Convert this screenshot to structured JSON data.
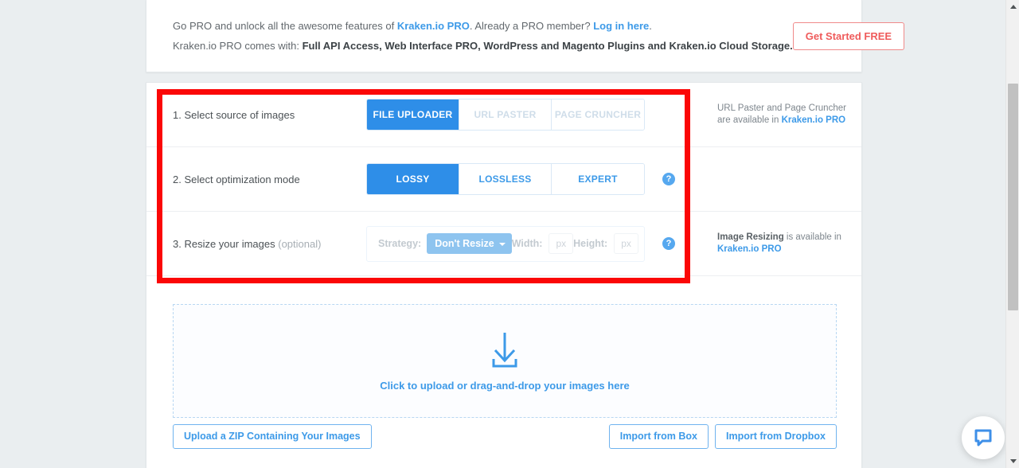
{
  "banner": {
    "line1_part1": "Go PRO and unlock all the awesome features of ",
    "line1_link1": "Kraken.io PRO",
    "line1_part2": ". Already a PRO member? ",
    "line1_link2": "Log in here",
    "line1_part3": ".",
    "line2_part1": "Kraken.io PRO comes with: ",
    "line2_bold": "Full API Access, Web Interface PRO, WordPress and Magento Plugins and Kraken.io Cloud Storage.",
    "cta_label": "Get Started FREE"
  },
  "steps": {
    "step1": {
      "label": "1. Select source of images",
      "options": [
        {
          "label": "FILE UPLOADER",
          "state": "active"
        },
        {
          "label": "URL PASTER",
          "state": "disabled"
        },
        {
          "label": "PAGE CRUNCHER",
          "state": "disabled"
        }
      ],
      "note_part1": "URL Paster and Page Cruncher",
      "note_part2": "are available in ",
      "note_link": "Kraken.io PRO"
    },
    "step2": {
      "label": "2. Select optimization mode",
      "options": [
        {
          "label": "LOSSY",
          "state": "active"
        },
        {
          "label": "LOSSLESS",
          "state": "normal"
        },
        {
          "label": "EXPERT",
          "state": "normal"
        }
      ],
      "help_glyph": "?"
    },
    "step3": {
      "label": "3. Resize your images ",
      "label_optional": "(optional)",
      "strategy_label": "Strategy:",
      "strategy_value": "Don't Resize",
      "width_label": "Width:",
      "width_value": "",
      "width_placeholder": "px",
      "height_label": "Height:",
      "height_value": "",
      "height_placeholder": "px",
      "help_glyph": "?",
      "note_bold": "Image Resizing",
      "note_part2": " is available in",
      "note_link": "Kraken.io PRO"
    }
  },
  "dropzone": {
    "text": "Click to upload or drag-and-drop your images here",
    "icon": "download-arrow-icon"
  },
  "bottom_buttons": {
    "zip": "Upload a ZIP Containing Your Images",
    "box": "Import from Box",
    "dropbox": "Import from Dropbox"
  },
  "chat_widget": {
    "icon": "chat-bubble-icon"
  },
  "annotation": {
    "color": "#fb0707",
    "shape": "rectangle-highlight"
  },
  "colors": {
    "accent_blue": "#2e8ee8",
    "link_blue": "#3d9ae8",
    "cta_red": "#ef5b5b",
    "page_bg": "#eaeef0",
    "highlight_red": "#fb0707"
  }
}
